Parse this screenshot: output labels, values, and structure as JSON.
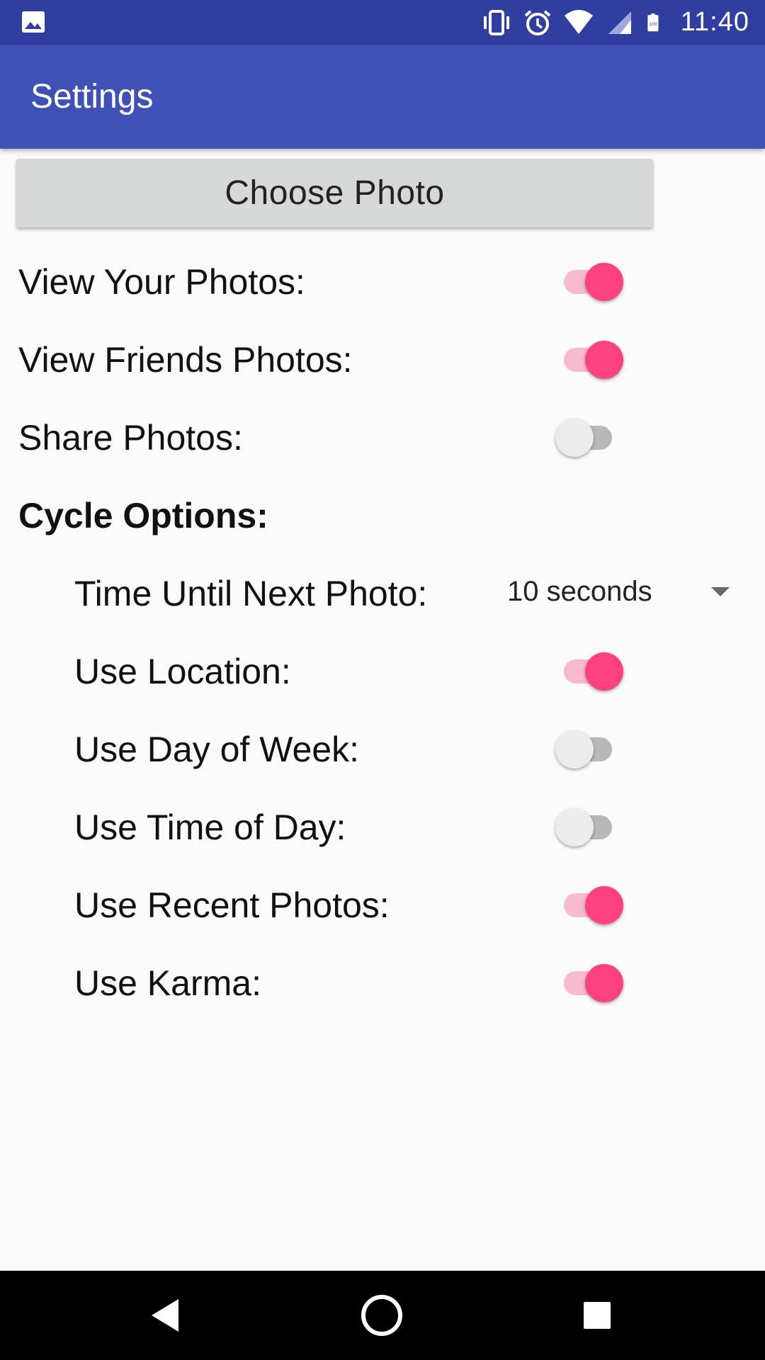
{
  "status_bar": {
    "time": "11:40",
    "icons": [
      "gallery-icon",
      "vibrate-icon",
      "alarm-icon",
      "wifi-icon",
      "signal-icon",
      "battery-icon"
    ],
    "battery_text": "100"
  },
  "app_bar": {
    "title": "Settings"
  },
  "choose_photo_button": "Choose Photo",
  "settings": {
    "view_your_photos": {
      "label": "View Your Photos:",
      "checked": true
    },
    "view_friends_photos": {
      "label": "View Friends Photos:",
      "checked": true
    },
    "share_photos": {
      "label": "Share Photos:",
      "checked": false
    }
  },
  "cycle_options": {
    "heading": "Cycle Options:",
    "time_until_next_photo": {
      "label": "Time Until Next Photo:",
      "value": "10 seconds"
    },
    "use_location": {
      "label": "Use Location:",
      "checked": true
    },
    "use_day_of_week": {
      "label": "Use Day of Week:",
      "checked": false
    },
    "use_time_of_day": {
      "label": "Use Time of Day:",
      "checked": false
    },
    "use_recent_photos": {
      "label": "Use Recent Photos:",
      "checked": true
    },
    "use_karma": {
      "label": "Use Karma:",
      "checked": true
    }
  },
  "nav_bar": {
    "icons": [
      "back-icon",
      "home-icon",
      "recents-icon"
    ]
  },
  "colors": {
    "status_bar": "#303f9f",
    "app_bar": "#3f51b5",
    "switch_on_thumb": "#ff4081",
    "switch_on_track": "#f7bad0",
    "switch_off_thumb": "#ececec",
    "switch_off_track": "#b8b8b8",
    "background": "#fafafa"
  }
}
